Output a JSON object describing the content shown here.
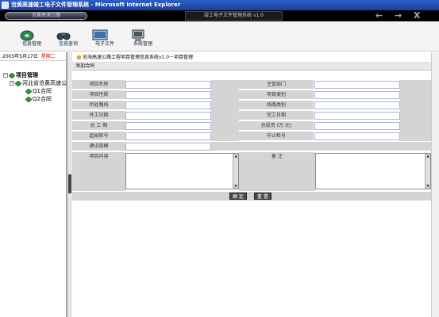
{
  "window": {
    "title": "沧黄高速竣工电子文件管理系统 - Microsoft Internet Explorer"
  },
  "banner": {
    "left_label": "沧黄高速公路",
    "center_title": "竣工电子文件管理系统 v1.0",
    "back": "←",
    "forward": "→",
    "close": "X"
  },
  "toolbar": {
    "items": [
      {
        "label": "信息管理",
        "icon": "disk-icon"
      },
      {
        "label": "信息查询",
        "icon": "binoculars-icon"
      },
      {
        "label": "电子文件",
        "icon": "screen-icon"
      },
      {
        "label": "系统管理",
        "icon": "computer-icon"
      }
    ]
  },
  "sidebar": {
    "date": "2005年5月17日",
    "weekday": "星期二",
    "tree": {
      "root": "项目管理",
      "child": "河北省沧黄高速公",
      "leaves": [
        "Q1合同",
        "Q2合同"
      ]
    }
  },
  "main": {
    "breadcrumb": "沧海高速公路工程项目管理信息系统v1.0－项目管理",
    "section": "添加合同",
    "fields": {
      "left": [
        "项目名称",
        "项目性质",
        "所处路线",
        "开工日期",
        "总 工 期",
        "起始桩号",
        "建设规模"
      ],
      "right": [
        "主管部门",
        "项目类别",
        "线路类别",
        "完工日期",
        "总投资 (万 元)",
        "中止桩号"
      ],
      "content_left": "项目内容",
      "content_right": "备    注"
    },
    "buttons": {
      "confirm": "确 定",
      "reset": "重 置"
    }
  },
  "colors": {
    "title_bar": "#1b3f99",
    "banner": "#000000",
    "label_bg": "#d4d4d4",
    "tree_green": "#2f9a3a",
    "weekday": "#cc0000"
  }
}
